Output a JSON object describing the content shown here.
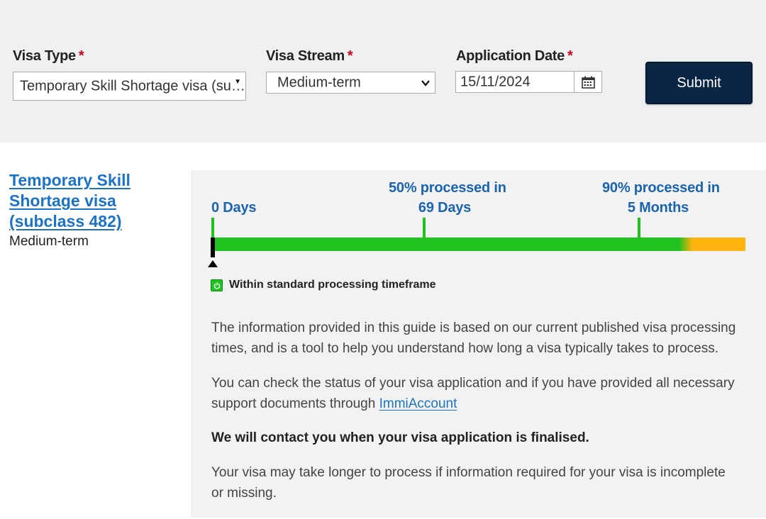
{
  "form": {
    "visa_type": {
      "label": "Visa Type",
      "required_mark": "*",
      "value": "Temporary Skill Shortage visa (su…"
    },
    "visa_stream": {
      "label": "Visa Stream",
      "required_mark": "*",
      "value": "Medium-term"
    },
    "application_date": {
      "label": "Application Date",
      "required_mark": "*",
      "value": "15/11/2024"
    },
    "submit_label": "Submit"
  },
  "result": {
    "visa_title_lines": [
      "Temporary Skill",
      "Shortage visa",
      "(subclass 482)"
    ],
    "stream": "Medium-term",
    "timeline": {
      "start": {
        "label": "0 Days"
      },
      "p50": {
        "line1": "50% processed in",
        "line2": "69 Days"
      },
      "p90": {
        "line1": "90% processed in",
        "line2": "5 Months"
      },
      "status_colors": {
        "within": "#1fc21f",
        "beyond": "#ffb30f"
      }
    },
    "legend": {
      "label": "Within standard processing timeframe",
      "icon": "power-icon"
    },
    "paragraphs": {
      "p1_line1": "The information provided in this guide is based on our current published visa processing",
      "p1_line2": "times, and is a tool to help you understand how long a visa typically takes to process.",
      "p2_line1": "You can check the status of your visa application and if you have provided all necessary",
      "p2_line2_prefix": "support documents through ",
      "p2_link": "ImmiAccount",
      "p3": "We will contact you when your visa application is finalised.",
      "p4_line1": "Your visa may take longer to process if information required for your visa is incomplete",
      "p4_line2": "or missing."
    }
  },
  "colors": {
    "submit_bg": "#0b2545",
    "link": "#1a73c9",
    "required": "#d0021b",
    "filter_bg": "#f0f0f0",
    "panel_bg": "#f2f2f2"
  }
}
